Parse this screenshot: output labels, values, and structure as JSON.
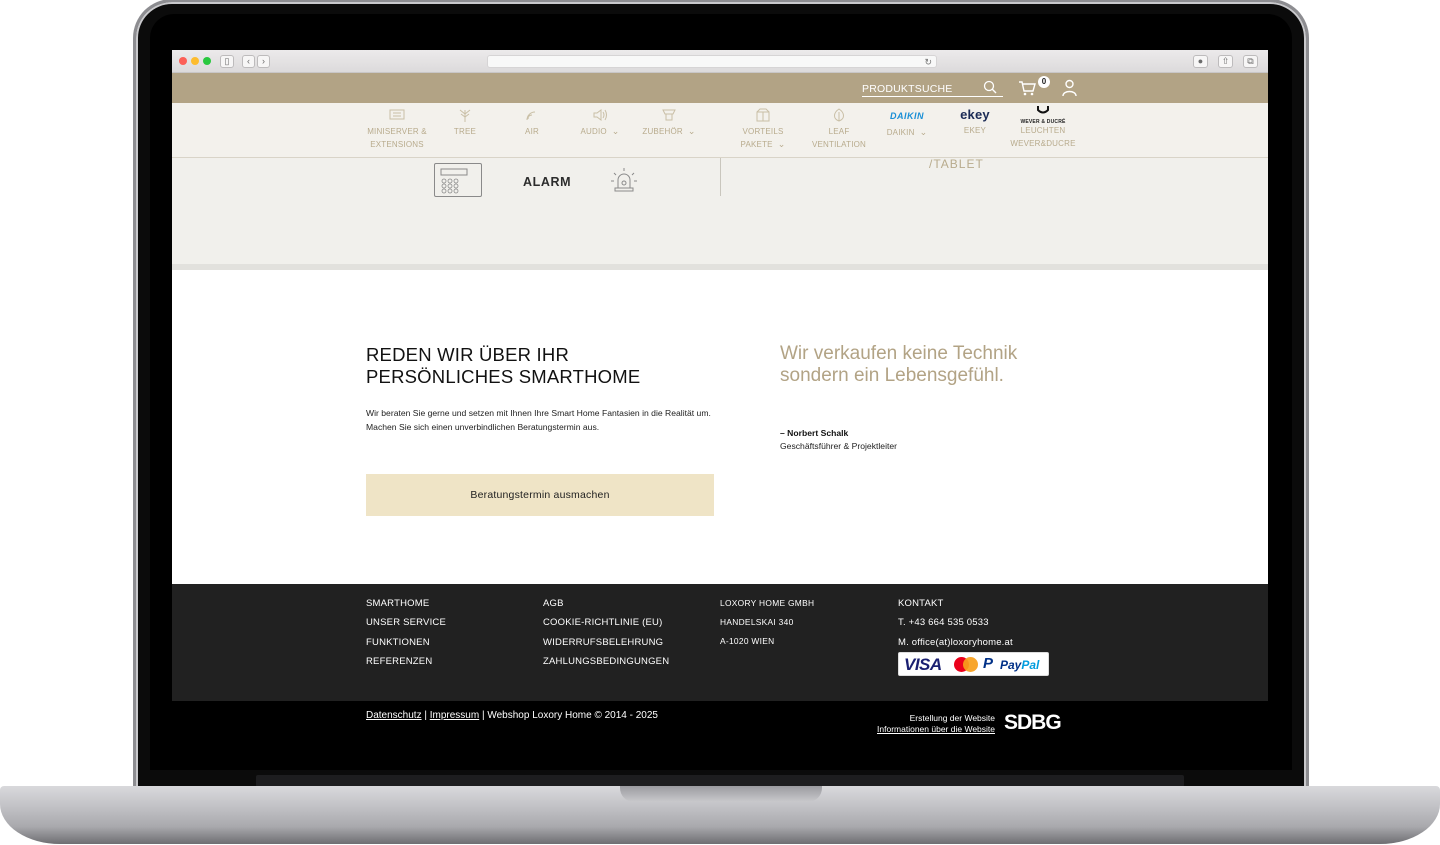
{
  "header": {
    "search_placeholder": "PRODUKTSUCHE",
    "cart_count": "0"
  },
  "nav": {
    "items": [
      {
        "label": "MINISERVER &\nEXTENSIONS",
        "icon": "miniserver-icon",
        "chevron": ""
      },
      {
        "label": "TREE",
        "icon": "tree-icon",
        "chevron": ""
      },
      {
        "label": "AIR",
        "icon": "air-icon",
        "chevron": ""
      },
      {
        "label": "AUDIO",
        "icon": "speaker-icon",
        "chevron": "⌄"
      },
      {
        "label": "ZUBEHÖR",
        "icon": "accessory-icon",
        "chevron": "⌄"
      },
      {
        "label": "VORTEILS\nPAKETE",
        "icon": "package-icon",
        "chevron": "⌄"
      },
      {
        "label": "LEAF\nVENTILATION",
        "icon": "leaf-icon",
        "chevron": ""
      },
      {
        "label": "DAIKIN",
        "logo": "DAIKIN",
        "chevron": "⌄"
      },
      {
        "label": "EKEY",
        "logo": "ekey"
      },
      {
        "label": "LEUCHTEN\nWEVER&DUCRE",
        "logo": "WEVER & DUCRÉ"
      }
    ]
  },
  "band": {
    "alarm_label": "ALARM",
    "tablet_label": "/TABLET"
  },
  "cta": {
    "title": "REDEN WIR ÜBER IHR PERSÖNLICHES SMARTHOME",
    "text": "Wir beraten Sie gerne und setzen mit Ihnen Ihre Smart Home Fantasien in die Realität um. Machen Sie sich einen unverbindlichen Beratungstermin aus.",
    "button": "Beratungstermin ausmachen"
  },
  "quote": {
    "text": "Wir verkaufen keine Technik sondern ein Lebensgefühl.",
    "author": "– Norbert Schalk",
    "role": "Geschäftsführer & Projektleiter"
  },
  "footer": {
    "col1": [
      "SMARTHOME",
      "UNSER SERVICE",
      "FUNKTIONEN",
      "REFERENZEN"
    ],
    "col2": [
      "AGB",
      "COOKIE-RICHTLINIE (EU)",
      "WIDERRUFSBELEHRUNG",
      "ZAHLUNGSBEDINGUNGEN"
    ],
    "col3": [
      "LOXORY HOME GMBH",
      "HANDELSKAI 340",
      "A-1020 WIEN"
    ],
    "col4": [
      "KONTAKT",
      "T. +43 664 535 0533",
      "M. office(at)loxoryhome.at"
    ],
    "payment": {
      "visa": "VISA",
      "paypal_pay": "Pay",
      "paypal_pal": "Pal"
    }
  },
  "bottom": {
    "datenschutz": "Datenschutz",
    "sep": " | ",
    "impressum": "Impressum",
    "copyright": " | Webshop Loxory Home © 2014 - 2025",
    "credit_line1": "Erstellung der Website",
    "credit_line2": "Informationen über die Website",
    "credit_logo": "SDBG"
  }
}
